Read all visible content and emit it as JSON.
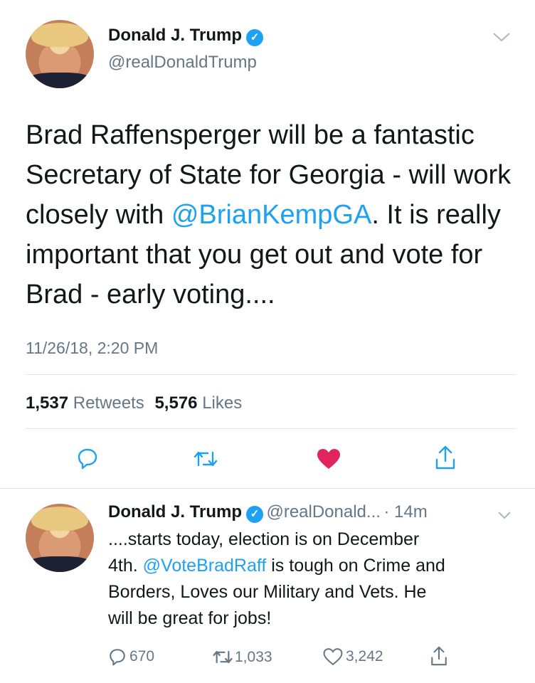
{
  "tweet": {
    "author_name": "Donald J. Trump",
    "author_handle": "@realDonaldTrump",
    "text_lines": [
      "Brad Raffensperger will be a fantastic",
      "Secretary of State for Georgia - will work"
    ],
    "line3_pre": "closely with ",
    "line3_mention": "@BrianKempGA",
    "line3_post": ". It is really",
    "line4": "important that you get out and vote for",
    "line5": "Brad - early voting....",
    "timestamp": "11/26/18, 2:20 PM",
    "retweets_count": "1,537",
    "retweets_label": "Retweets",
    "likes_count": "5,576",
    "likes_label": "Likes"
  },
  "reply": {
    "author_name": "Donald J. Trump",
    "author_handle": "@realDonald...",
    "time": "· 14m",
    "line1": "....starts today, election is on December",
    "line2_pre": "4th. ",
    "line2_mention": "@VoteBradRaff",
    "line2_post": " is tough on Crime and",
    "line3": "Borders, Loves our Military and Vets. He",
    "line4": "will be great for jobs!",
    "replies_count": "670",
    "retweets_count": "1,033",
    "likes_count": "3,242"
  },
  "colors": {
    "accent": "#1da1f2",
    "like_active": "#e0245e",
    "muted": "#657786"
  },
  "icons": [
    "chevron-down-icon",
    "verified-icon",
    "reply-icon",
    "retweet-icon",
    "like-icon",
    "share-icon"
  ]
}
